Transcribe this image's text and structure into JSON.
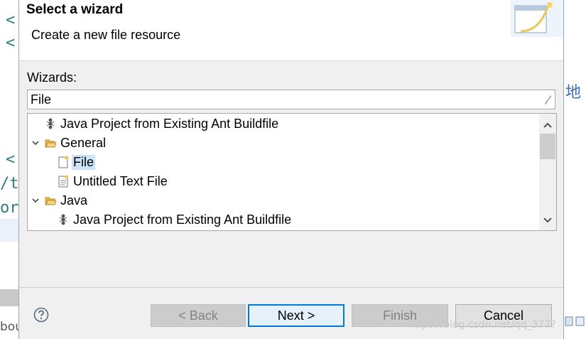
{
  "background": {
    "code_fragments": [
      "<",
      "<",
      "<",
      "/t",
      "or"
    ],
    "bottom_text": "bou",
    "right_cjk": "地"
  },
  "dialog": {
    "banner": {
      "title": "Select a wizard",
      "description": "Create a new file resource"
    },
    "wizards_label": "Wizards:",
    "filter": {
      "value": "File",
      "placeholder": ""
    },
    "tree": {
      "items": [
        {
          "label": "Java Project from Existing Ant Buildfile",
          "icon": "ant-icon",
          "level": 1,
          "expandable": false,
          "expanded": false,
          "selected": false
        },
        {
          "label": "General",
          "icon": "folder-open-icon",
          "level": 0,
          "expandable": true,
          "expanded": true,
          "selected": false
        },
        {
          "label": "File",
          "icon": "new-file-icon",
          "level": 1,
          "expandable": false,
          "expanded": false,
          "selected": true
        },
        {
          "label": "Untitled Text File",
          "icon": "text-file-icon",
          "level": 1,
          "expandable": false,
          "expanded": false,
          "selected": false
        },
        {
          "label": "Java",
          "icon": "folder-open-icon",
          "level": 0,
          "expandable": true,
          "expanded": true,
          "selected": false
        },
        {
          "label": "Java Project from Existing Ant Buildfile",
          "icon": "ant-icon",
          "level": 1,
          "expandable": false,
          "expanded": false,
          "selected": false
        }
      ]
    },
    "buttons": {
      "back": "< Back",
      "next": "Next >",
      "finish": "Finish",
      "cancel": "Cancel"
    },
    "help_icon": "help-icon"
  },
  "watermark": "https://blog.csdn.net/qq_377?",
  "colors": {
    "selection": "#cce4f7",
    "default_button_border": "#0078d7",
    "dialog_bg": "#f0f0f0"
  }
}
